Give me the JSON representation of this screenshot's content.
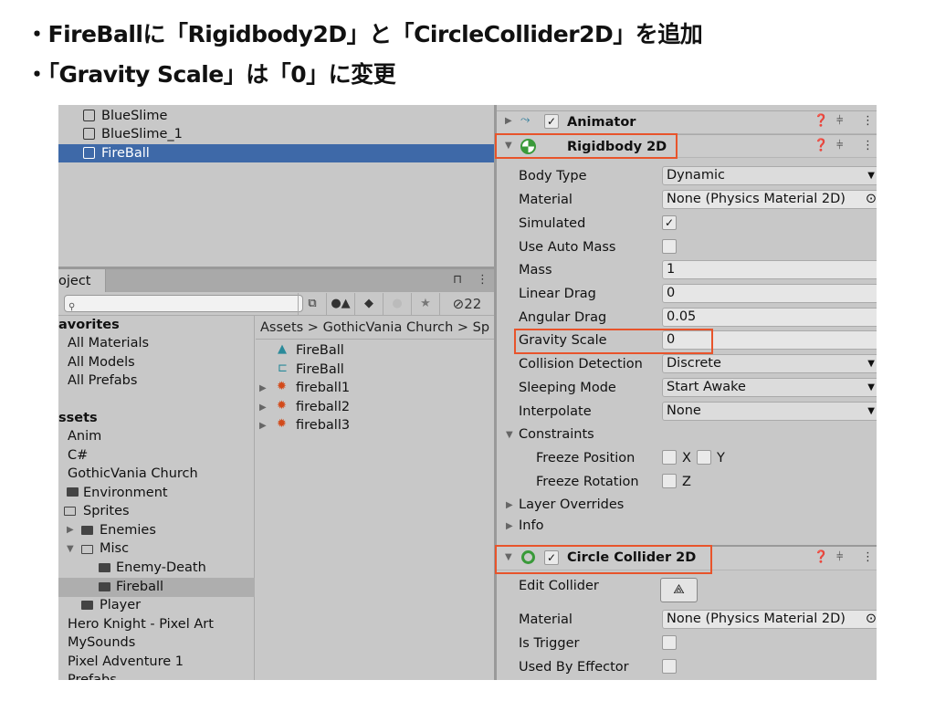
{
  "slide": {
    "bullets": [
      "・FireBallに「Rigidbody2D」と「CircleCollider2D」を追加",
      "・「Gravity Scale」は「0」に変更"
    ]
  },
  "hierarchy": {
    "items": [
      "BlueSlime",
      "BlueSlime_1",
      "FireBall"
    ],
    "selected": "FireBall"
  },
  "project": {
    "tab": "oject",
    "hidden_count": "22",
    "favorites_header": "avorites",
    "favorites": [
      "All Materials",
      "All Models",
      "All Prefabs"
    ],
    "assets_header": "ssets",
    "tree": [
      "Anim",
      "C#",
      "GothicVania Church",
      "Environment",
      "Sprites",
      "Enemies",
      "Misc",
      "Enemy-Death",
      "Fireball",
      "Player",
      "Hero Knight - Pixel Art",
      "MySounds",
      "Pixel Adventure 1",
      "Prefabs"
    ],
    "breadcrumb": [
      "Assets",
      "GothicVania Church",
      "Sp"
    ],
    "files": [
      "FireBall",
      "FireBall",
      "fireball1",
      "fireball2",
      "fireball3"
    ]
  },
  "inspector": {
    "animator": "Animator",
    "rigidbody": {
      "title": "Rigidbody 2D",
      "labels": [
        "Body Type",
        "Material",
        "Simulated",
        "Use Auto Mass",
        "Mass",
        "Linear Drag",
        "Angular Drag",
        "Gravity Scale",
        "Collision Detection",
        "Sleeping Mode",
        "Interpolate"
      ],
      "body_type": "Dynamic",
      "material": "None (Physics Material 2D)",
      "simulated": true,
      "use_auto_mass": false,
      "mass": "1",
      "linear_drag": "0",
      "angular_drag": "0.05",
      "gravity_scale": "0",
      "collision_detection": "Discrete",
      "sleeping_mode": "Start Awake",
      "interpolate": "None",
      "constraints": "Constraints",
      "freeze_position": "Freeze Position",
      "freeze_rotation": "Freeze Rotation",
      "x": "X",
      "y": "Y",
      "z": "Z",
      "layer_overrides": "Layer Overrides",
      "info": "Info"
    },
    "circle_collider": {
      "title": "Circle Collider 2D",
      "labels": [
        "Edit Collider",
        "Material",
        "Is Trigger",
        "Used By Effector"
      ],
      "material": "None (Physics Material 2D)"
    }
  },
  "colors": {
    "selection": "#3e69a8",
    "highlight": "#e8542b",
    "rigidbody_icon": "#3a9a3a"
  }
}
